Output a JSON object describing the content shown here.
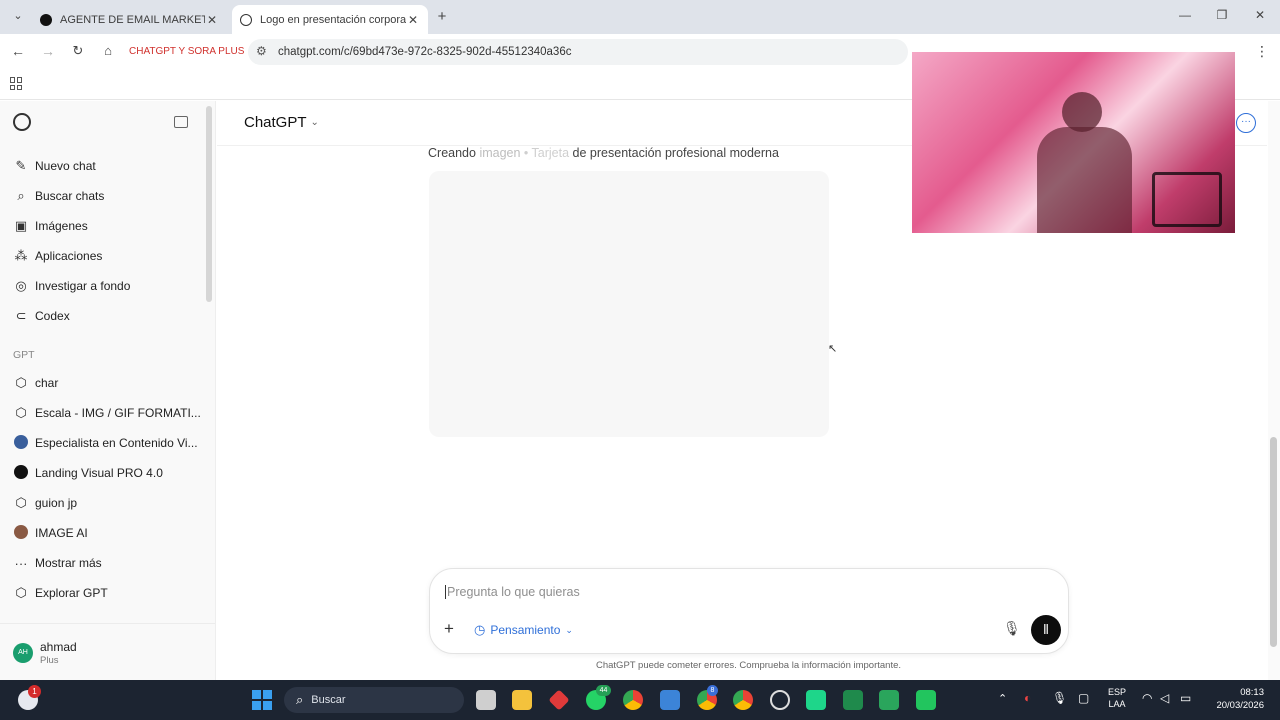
{
  "browser": {
    "tabs": [
      {
        "title": "AGENTE DE EMAIL MARKETING",
        "active": false
      },
      {
        "title": "Logo en presentación corporat",
        "active": true
      }
    ],
    "bookmark_label": "CHATGPT Y SORA PLUS",
    "url": "chatgpt.com/c/69bd473e-972c-8325-902d-45512340a36c"
  },
  "sidebar": {
    "items": [
      {
        "icon": "edit-icon",
        "label": "Nuevo chat"
      },
      {
        "icon": "search-icon",
        "label": "Buscar chats"
      },
      {
        "icon": "image-icon",
        "label": "Imágenes"
      },
      {
        "icon": "apps-icon",
        "label": "Aplicaciones"
      },
      {
        "icon": "research-icon",
        "label": "Investigar a fondo"
      },
      {
        "icon": "codex-icon",
        "label": "Codex"
      }
    ],
    "section_label": "GPT",
    "gpts": [
      {
        "icon": "cube-icon",
        "label": "char"
      },
      {
        "icon": "cube-icon",
        "label": "Escala - IMG / GIF FORMATI..."
      },
      {
        "icon": "globe-avatar-icon",
        "label": "Especialista en Contenido Vi..."
      },
      {
        "icon": "dark-avatar-icon",
        "label": "Landing Visual PRO 4.0"
      },
      {
        "icon": "cube-icon",
        "label": "guion jp"
      },
      {
        "icon": "photo-avatar-icon",
        "label": "IMAGE AI"
      },
      {
        "icon": "more-icon",
        "label": "Mostrar más"
      },
      {
        "icon": "cube-icon",
        "label": "Explorar GPT"
      }
    ],
    "user": {
      "initials": "AH",
      "name": "ahmad",
      "plan": "Plus"
    }
  },
  "main": {
    "model_selector": "ChatGPT",
    "status_parts": [
      "Creando ",
      "imagen",
      " • Tarjeta",
      " de ",
      "presentación profesional moderna"
    ],
    "composer": {
      "placeholder": "Pregunta lo que quieras",
      "mode": "Pensamiento"
    },
    "disclaimer": "ChatGPT puede cometer errores. Comprueba la información importante."
  },
  "taskbar": {
    "search_placeholder": "Buscar",
    "lang_primary": "ESP",
    "lang_secondary": "LAA",
    "time": "08:13",
    "date": "20/03/2026",
    "badges": {
      "notifications": "1",
      "whatsapp": "44",
      "chrome2": "8"
    }
  },
  "colors": {
    "accent_blue": "#2f6fd8",
    "sidebar_bg": "#f9f9f9",
    "taskbar_bg": "#1c2431"
  }
}
